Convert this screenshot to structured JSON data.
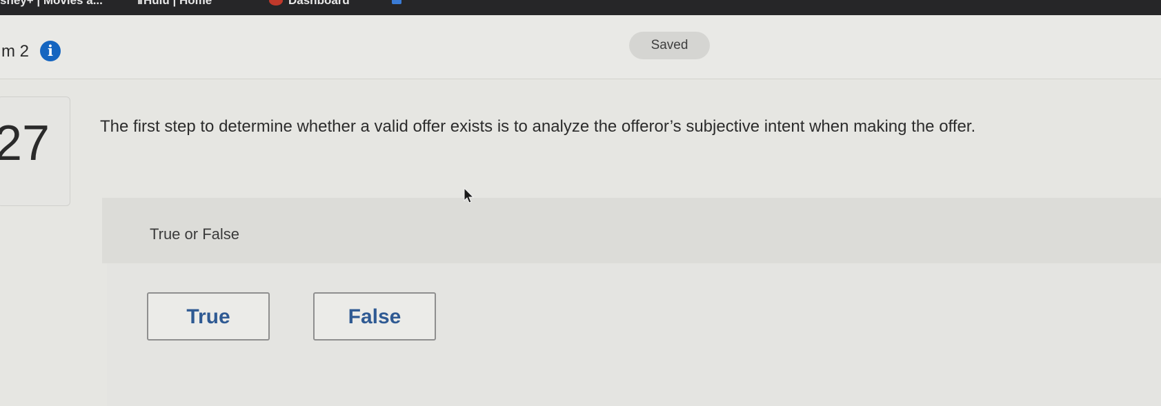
{
  "browser": {
    "bookmarks": [
      {
        "label": "sney+ | Movies a..."
      },
      {
        "label": "Hulu | Home"
      },
      {
        "label": "Dashboard"
      }
    ]
  },
  "header": {
    "module_label": "m 2",
    "info_icon": "info-icon",
    "saved_label": "Saved"
  },
  "question": {
    "number": "27",
    "text": "The first step to determine whether a valid offer exists is to analyze the offeror’s subjective intent when making the offer.",
    "instruction": "True or False",
    "choices": [
      {
        "label": "True"
      },
      {
        "label": "False"
      }
    ]
  },
  "colors": {
    "accent": "#1565c0",
    "choice_text": "#2f5a93",
    "bookmark_bar": "#262628"
  }
}
